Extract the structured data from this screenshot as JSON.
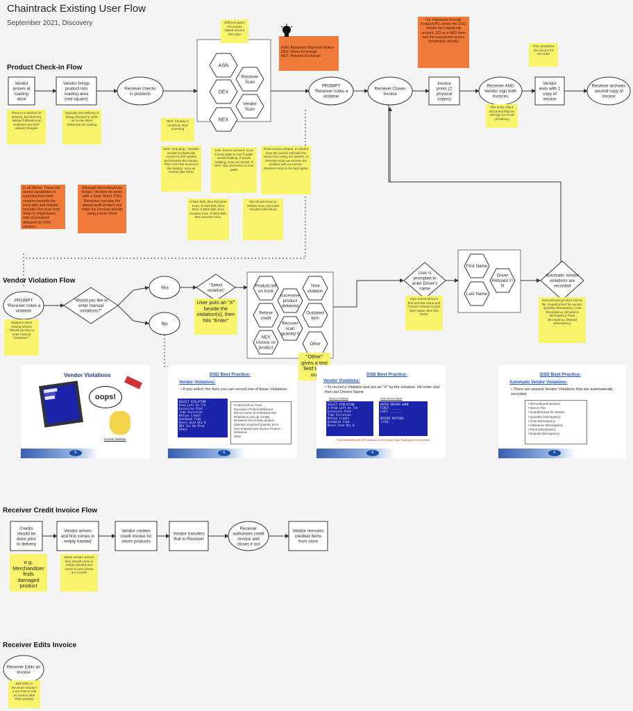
{
  "header": {
    "title": "Chaintrack Existing User Flow",
    "subtitle": "September 2021, Discovery"
  },
  "sections": {
    "check_in": "Product Check-in Flow",
    "violation": "Vendor Violation Flow",
    "credit": "Receiver Credit Invoice Flow",
    "edits": "Receiver Edits Invoice"
  },
  "checkin_nodes": {
    "vendor_arrives": [
      "Vendor",
      "arrives at",
      "loading",
      "dock"
    ],
    "vendor_brings": [
      "Vendor brings",
      "product into",
      "loading area",
      "(red square)"
    ],
    "receiver_checks": [
      "Receiver checks",
      "in products"
    ],
    "asn": "ASN",
    "dex": "DEX",
    "nex": "NEX",
    "receiver_scan": [
      "Receiver",
      "Scan"
    ],
    "vendor_scan": [
      "Vendor",
      "Scan"
    ],
    "prompt": [
      "PROMPT",
      "\"Receiver notes a",
      "violation"
    ],
    "closes": [
      "Receiver Closes",
      "Invoice"
    ],
    "prints": [
      "Invoice",
      "prints (2",
      "physical",
      "copies)"
    ],
    "sign": [
      "Receiver AND",
      "Vendor sign both",
      "invoices"
    ],
    "exits": [
      "Vendor",
      "exits with 1",
      "copy of",
      "invoice"
    ],
    "archives": [
      "Receiver archives",
      "second copy of",
      "invoice"
    ]
  },
  "violation_nodes": {
    "prompt": [
      "PROMPT",
      "\"Receiver notes a",
      "violation"
    ],
    "enter_manual": [
      "\"Would you like to",
      "enter manual",
      "violations?\""
    ],
    "yes": "Yes",
    "no": "No",
    "select": [
      "\"Select",
      "violation\""
    ],
    "hex_product_left": [
      "Product left",
      "on truck"
    ],
    "hex_time": [
      "Time",
      "violation"
    ],
    "hex_excessive": [
      "Excessive",
      "product",
      "delivered"
    ],
    "hex_refuse": [
      "Refuse",
      "credit"
    ],
    "hex_outdated": [
      "Outdated",
      "item"
    ],
    "hex_recover": [
      "Recover",
      "scan",
      "quantity 0"
    ],
    "hex_nex_invoice": [
      "NEX",
      "Invoice no",
      "product"
    ],
    "hex_other": "Other",
    "driver_prompt": [
      "User is",
      "prompted to",
      "enter Driver's",
      "name"
    ],
    "first_name": "First Name",
    "last_name": "Last Name",
    "driver_refused": [
      "Driver",
      "Refused Y/",
      "N"
    ],
    "auto_recorded": [
      "Automatic vendor",
      "violations are",
      "recorded"
    ]
  },
  "credit_nodes": {
    "credits": [
      "Credits",
      "should be",
      "done prior",
      "to delivery"
    ],
    "vendor_arrives": [
      "Vendor arrives",
      "and first comes in",
      "empty handed"
    ],
    "vendor_creates": [
      "Vendor creates",
      "credit invoice for",
      "return products"
    ],
    "transfers": [
      "Vendor transfers",
      "that to Receiver"
    ],
    "authorizes": [
      "Receiver",
      "authorizes credit",
      "invoice and",
      "closes it out"
    ],
    "removes": [
      "Vendor removes",
      "credited items",
      "from store"
    ]
  },
  "edits_nodes": {
    "edits": [
      "Receiver Edits an",
      "Invoice"
    ]
  },
  "stickies": {
    "s_types": "Different types of invoices based around EDI data",
    "s_window": "There is a window for delivery, but that isn't always followed and violations are NOT always charged",
    "s_one_delivery": "Typically one Delivery is being checked in while up to two other deliveries are waiting",
    "s_nex": "NEX: Already in menthod, start scanning",
    "s_dex": "DEX: Amp plug - ossciles vendor to physically connect to the system and transmit the invoice. Then once the invoice in the system, scan as normal (like NEX)",
    "s_asn": "ASN: Invoice present. Scan license plate to see if pallet needs building. If needs building, scan as normal. If NOT, skip and move to next pallet",
    "s_noinvoice": "If NO invoice present. In Vendor scan the vendor will build the invoice live using our system. In Receiver scan we receive the product with no invoice. Receiver scan is the last option",
    "s_nexfails": "If NEX fails, then Receiver Scan. If ASN fails, then DEX. If DEX fails, then receiver scan. If DEX fails, then receiver scan.",
    "s_move": "We should move to Vendor Scan, but more Vendor's will refuse",
    "s_print": "This is the ONLY document that we will sign for Proof of Delivery",
    "s_completes": "This completes the invoice for the order",
    "s_happens": "Happens when closing invoice \"Would you like to enter manual violations?\"",
    "s_puts_x": "User puts an \"X\" beside the violation(s), then hits \"Enter\"",
    "s_other": "\"Other\" gives a text field to fill out",
    "s_enters": "User enters Driver's first and last name and if Driver refused to give their name, then hits 'Enter'",
    "s_auto": "Discontinued product Not on file. Unauthorized for vendor. Quantity discrepancy. Cost Discrepancy. Allowance discrepancy. Pack discrepancy. Deposit Discrepancy",
    "s_eg": "e.g. Merchandiser finds damaged product",
    "s_empty": "When Vendor arrives they should come in empty handed and check to see if there are Credits",
    "s_edits": "BEFORE or Receiver-Vendor? y-our how to edit an invoice after their quantity"
  },
  "orange_notes": {
    "o_asn": "ASN: Advanced Shipment Notice\nDEX: Direct Exchange\nNEX: Network Exchange",
    "o_fedex": "For shipments through FedEx/UPS, where the DSD Vendor isn't physically present, EDI is in NEX form and the transaction occurs completely virtually",
    "o_left1": "In all Stores: These are stored capabilities to scanning from their vendors towards the truck side and outside. Includes Pre-scan from Shop to ship/release onto all products delivered by DSD vendors",
    "o_left2": "Although discontinued by Kroger, Vendors do arrive with a Scan Sheet. DSD Receivers can play the annual audit product and make the invoices directly using a scan sheet"
  },
  "slides": {
    "slide1": {
      "title": "Vendor Violations",
      "oops": "oops!",
      "caption": "Honest Mistake"
    },
    "slide2": {
      "title": "DSD Best Practice:",
      "sub": "Vendor Violations:",
      "bullet": "If you select Yes then you can record one of these Violations:",
      "list": [
        "Product left on Truck",
        "Excessive Product Delivered",
        "Did not arrive at scheduled time",
        "Refused to pick up Credits",
        "Delivered Out of Date product",
        "Operator Scanned Quantity Error",
        "Non-Scanned and Invoice Product Delivered",
        "Other"
      ]
    },
    "slide3": {
      "title": "DSD Best Practice:",
      "sub": "Vendor Violations:",
      "bullet": "To record a Violation just put an \"X\" by the violation. Hit enter and then put Drivers Name",
      "label1": "Record Violations",
      "label2": "Enter Drivers Name",
      "note": "*This information will NOT show up on the Chain Track Ticket given to the Driver."
    },
    "slide4": {
      "title": "DSD Best Practice:",
      "sub": "Automatic Vendor Violations:",
      "bullet": "There are several Vendor Violations that are automatically recorded.",
      "list": [
        "Discontinued product",
        "Not on File",
        "Unauthorized for Vendor",
        "Quantity Discrepancy",
        "Cost Discrepancy",
        "Allowance Discrepancy",
        "Pack Discrepancy",
        "Deposit Discrepancy"
      ]
    }
  },
  "colors": {
    "sticky": "#f7f36a",
    "orange": "#f07a3a",
    "node_fill": "#ffffff",
    "stroke": "#333333"
  }
}
